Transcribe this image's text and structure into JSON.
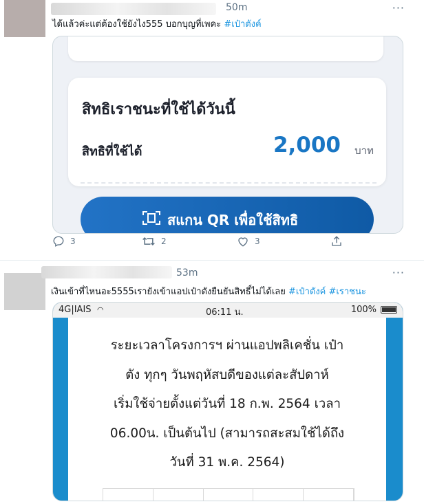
{
  "tweet1": {
    "time": "50m",
    "text": "ได้แล้วค่ะแต่ต้องใช้ยังไง555 บอกบุญที่เพคะ",
    "hashtag": "#เป๋าตังค์",
    "media": {
      "title": "สิทธิเราชนะที่ใช้ได้วันนี้",
      "label": "สิทธิที่ใช้ได้",
      "amount": "2,000",
      "unit": "บาท",
      "button": "สแกน QR เพื่อใช้สิทธิ"
    },
    "actions": {
      "replies": "3",
      "retweets": "2",
      "likes": "3"
    }
  },
  "tweet2": {
    "time": "53m",
    "text": "เงินเข้าที่ไหนอะ5555เรายังเข้าแอปเป๋าตังยืนยันสิทธิ์ไม่ได้เลย",
    "hashtag1": "#เป๋าตังค์",
    "hashtag2": "#เราชนะ",
    "media": {
      "status": {
        "carrier": "4G|IAIS",
        "clock": "06:11 น.",
        "battery": "100%"
      },
      "lines": [
        "ระยะเวลาโครงการฯ ผ่านแอปพลิเคชั่น เป๋า",
        "ตัง ทุกๆ วันพฤหัสบดีของแต่ละสัปดาห์",
        "เริ่มใช้จ่ายตั้งแต่วันที่ 18 ก.พ. 2564 เวลา",
        "06.00น. เป็นต้นไป (สามารถสะสมใช้ได้ถึง",
        "วันที่ 31 พ.ค. 2564)"
      ]
    }
  },
  "colors": {
    "hashtag": "#1b95e0",
    "amount": "#1976c4",
    "button": "#1565b5",
    "muted": "#5b7083"
  },
  "icons": [
    "reply-icon",
    "retweet-icon",
    "like-icon",
    "share-icon",
    "more-icon",
    "scan-icon",
    "wifi-icon",
    "battery-icon"
  ]
}
